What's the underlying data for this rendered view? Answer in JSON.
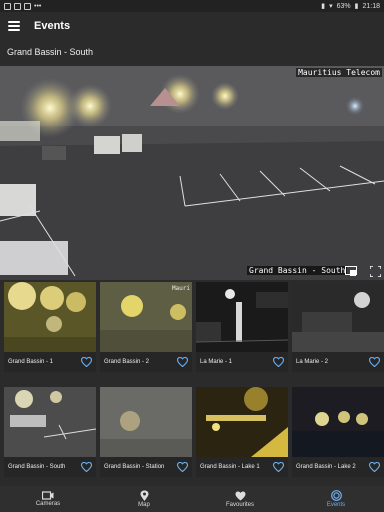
{
  "status": {
    "battery": "63%",
    "time": "21:18"
  },
  "appbar": {
    "title": "Events"
  },
  "camera": {
    "title": "Grand Bassin - South",
    "overlay_top_right": "Mauritius Telecom",
    "overlay_bottom": "Grand Bassin - South"
  },
  "tiles": [
    {
      "label": "Grand Bassin - 1",
      "overlay": ""
    },
    {
      "label": "Grand Bassin - 2",
      "overlay": "Mauri"
    },
    {
      "label": "La Marie - 1",
      "overlay": ""
    },
    {
      "label": "La Marie - 2",
      "overlay": ""
    },
    {
      "label": "Grand Bassin - South",
      "overlay": ""
    },
    {
      "label": "Grand Bassin - Station",
      "overlay": ""
    },
    {
      "label": "Grand Bassin - Lake 1",
      "overlay": ""
    },
    {
      "label": "Grand Bassin - Lake 2",
      "overlay": ""
    }
  ],
  "nav": {
    "cameras": "Cameras",
    "map": "Map",
    "favourites": "Favourites",
    "events": "Events"
  },
  "colors": {
    "accent": "#6aaef0",
    "background": "#2b2b2b"
  }
}
